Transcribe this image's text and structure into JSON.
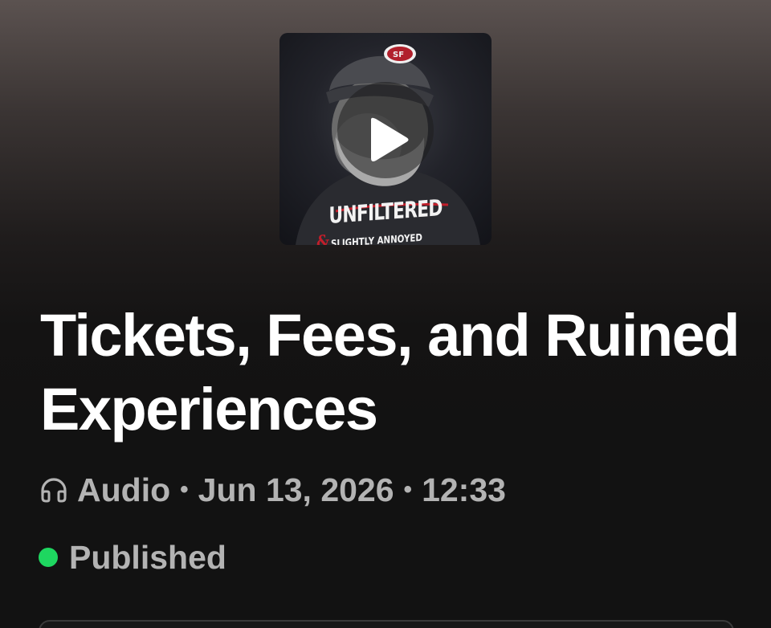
{
  "cover": {
    "title": "UNFILTERED",
    "subtitle_amp": "&",
    "subtitle": "SLIGHTLY ANNOYED"
  },
  "episode": {
    "title": "Tickets, Fees, and Ruined Experiences",
    "type_label": "Audio",
    "separator": "•",
    "date": "Jun 13, 2026",
    "duration": "12:33",
    "status": "Published"
  },
  "icons": {
    "play": "play-icon",
    "headphones": "headphones-icon",
    "status_dot": "status-dot-icon"
  },
  "colors": {
    "accent_green": "#1ed760",
    "meta_text": "#b3b3b3",
    "cover_red": "#c21e2a"
  }
}
